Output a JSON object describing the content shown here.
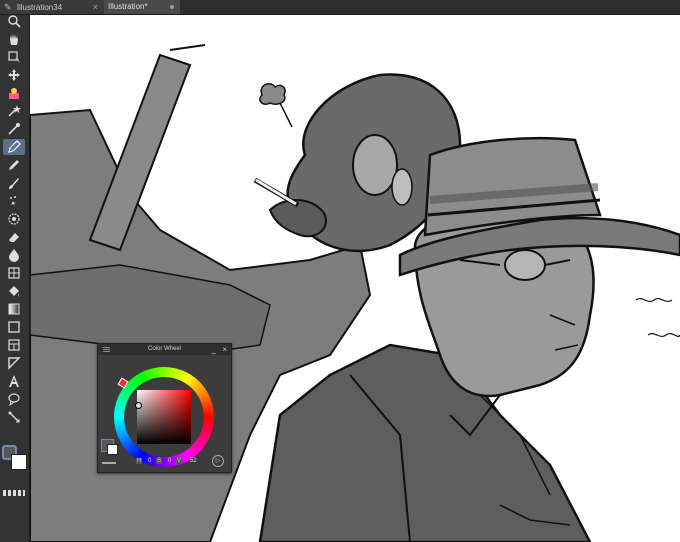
{
  "tabs": [
    {
      "label": "Illustration34",
      "close_glyph": "×",
      "active": false
    },
    {
      "label": "Illustration*",
      "active": true
    }
  ],
  "toolbar": {
    "tools": [
      "zoom-icon",
      "hand-icon",
      "rotate-icon",
      "move-icon",
      "auto-action-icon",
      "magic-wand-icon",
      "eyedropper-icon",
      "pen-icon",
      "pencil-icon",
      "brush-icon",
      "airbrush-icon",
      "decoration-icon",
      "eraser-icon",
      "blend-icon",
      "fill-icon",
      "gradient-icon",
      "figure-icon",
      "frame-icon",
      "ruler-icon",
      "text-icon",
      "balloon-icon",
      "correct-line-icon"
    ],
    "active_tool": "pen-icon",
    "main_color": "#55575a",
    "sub_color": "#ffffff"
  },
  "color_wheel": {
    "title": "Color Wheel",
    "h_key": "H",
    "h_value": "0",
    "s_key": "S",
    "s_value": "0",
    "v_key": "V",
    "v_value": "52"
  }
}
